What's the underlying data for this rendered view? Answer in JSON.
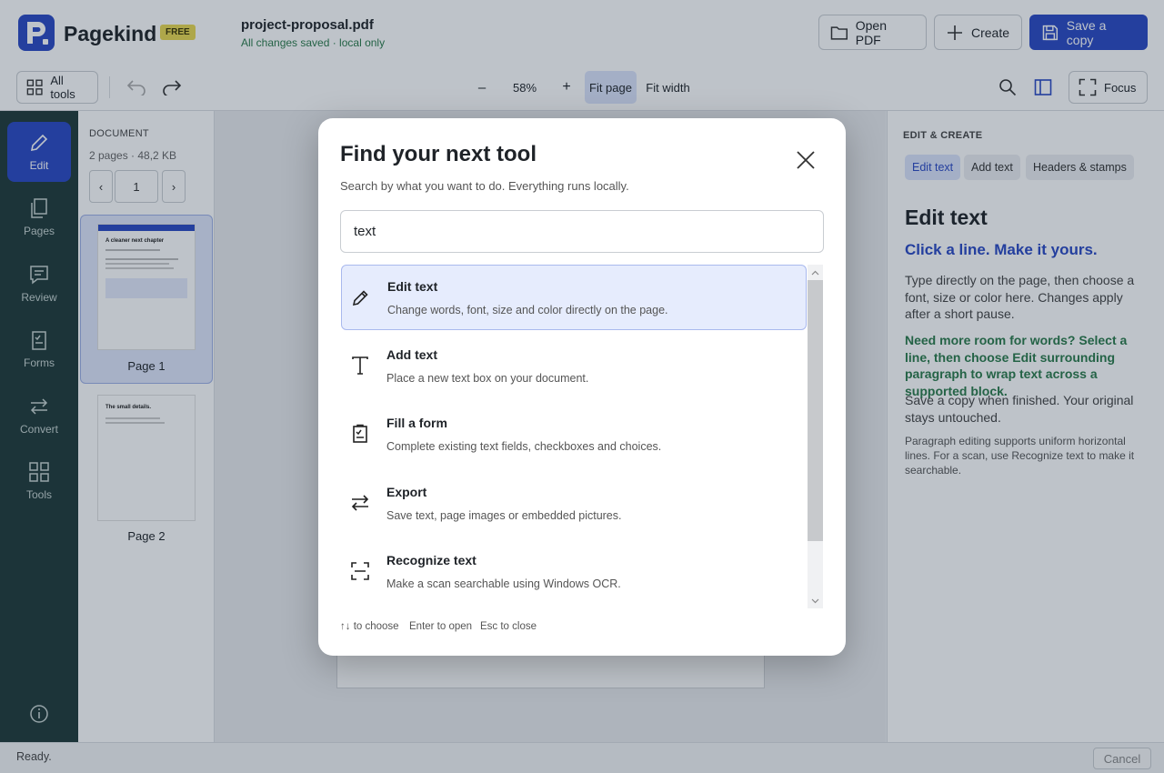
{
  "app": {
    "name": "Pagekind",
    "badge": "FREE"
  },
  "file": {
    "name": "project-proposal.pdf",
    "status": "All changes saved · local only"
  },
  "header_buttons": {
    "open": "Open PDF",
    "create": "Create",
    "save": "Save a copy"
  },
  "toolbar": {
    "all_tools": "All tools",
    "zoom_out": "–",
    "zoom": "58%",
    "zoom_in": "+",
    "fit_page": "Fit page",
    "fit_width": "Fit width",
    "focus": "Focus"
  },
  "rail": [
    {
      "label": "Edit",
      "icon": "pencil-icon"
    },
    {
      "label": "Pages",
      "icon": "pages-icon"
    },
    {
      "label": "Review",
      "icon": "comment-icon"
    },
    {
      "label": "Forms",
      "icon": "form-icon"
    },
    {
      "label": "Convert",
      "icon": "convert-icon"
    },
    {
      "label": "Tools",
      "icon": "grid-icon"
    }
  ],
  "document": {
    "label": "DOCUMENT",
    "meta": "2 pages · 48,2 KB",
    "prev": "‹",
    "page_input": "1",
    "next": "›",
    "pages": [
      {
        "label": "Page 1",
        "preview_heading": "A cleaner next chapter"
      },
      {
        "label": "Page 2",
        "preview_heading": "The small details."
      }
    ]
  },
  "right_panel": {
    "section": "EDIT & CREATE",
    "chips": [
      "Edit text",
      "Add text",
      "Headers & stamps"
    ],
    "title": "Edit text",
    "subtitle": "Click a line. Make it yours.",
    "body1": "Type directly on the page, then choose a font, size or color here. Changes apply after a short pause.",
    "tip": "Need more room for words? Select a line, then choose Edit surrounding paragraph to wrap text across a supported block.",
    "body2": "Save a copy when finished. Your original stays untouched.",
    "note": "Paragraph editing supports uniform horizontal lines. For a scan, use Recognize text to make it searchable."
  },
  "status": {
    "text": "Ready.",
    "cancel": "Cancel"
  },
  "modal": {
    "title": "Find your next tool",
    "subtitle": "Search by what you want to do. Everything runs locally.",
    "search_value": "text",
    "results": [
      {
        "name": "Edit text",
        "desc": "Change words, font, size and color directly on the page.",
        "icon": "pencil-icon"
      },
      {
        "name": "Add text",
        "desc": "Place a new text box on your document.",
        "icon": "text-icon"
      },
      {
        "name": "Fill a form",
        "desc": "Complete existing text fields, checkboxes and choices.",
        "icon": "form-icon"
      },
      {
        "name": "Export",
        "desc": "Save text, page images or embedded pictures.",
        "icon": "convert-icon"
      },
      {
        "name": "Recognize text",
        "desc": "Make a scan searchable using Windows OCR.",
        "icon": "scan-icon"
      }
    ],
    "hints": [
      "↑↓ to choose",
      "Enter to open",
      "Esc to close"
    ]
  },
  "colors": {
    "accent": "#2a48c4",
    "rail": "#1f3a38",
    "success": "#2a7a4a",
    "badge": "#e9d84f"
  }
}
